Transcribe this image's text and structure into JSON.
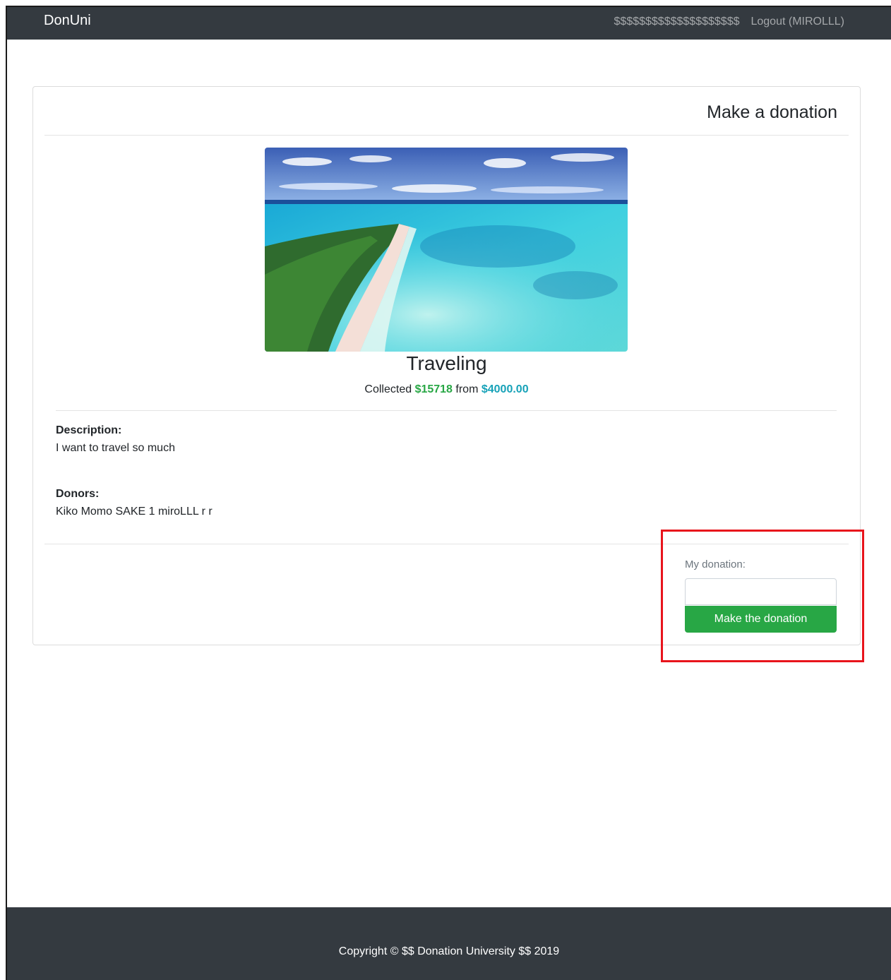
{
  "navbar": {
    "brand": "DonUni",
    "balance": "$$$$$$$$$$$$$$$$$$$$",
    "logout": "Logout (MIROLLL)"
  },
  "card": {
    "title": "Make a donation",
    "cause": {
      "title": "Traveling",
      "collected_prefix": "Collected",
      "collected_amount": "$15718",
      "collected_middle": "from",
      "goal_amount": "$4000.00"
    },
    "description_label": "Description:",
    "description_text": "I want to travel so much",
    "donors_label": "Donors:",
    "donors_text": "Kiko Momo SAKE 1 miroLLL r r"
  },
  "donation_form": {
    "label": "My donation:",
    "input_value": "",
    "button_label": "Make the donation"
  },
  "footer": {
    "copyright": "Copyright © $$ Donation University $$ 2019"
  },
  "colors": {
    "navbar_bg": "#343a40",
    "success": "#28a745",
    "info": "#17a2b8",
    "highlight": "#e8141c"
  }
}
